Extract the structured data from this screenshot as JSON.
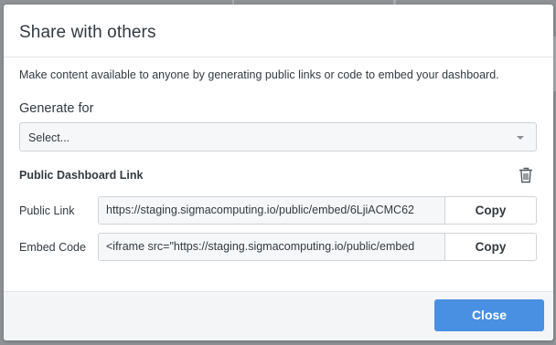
{
  "dialog": {
    "title": "Share with others",
    "description": "Make content available to anyone by generating public links or code to embed your dashboard.",
    "generate_label": "Generate for",
    "select": {
      "value": "Select..."
    },
    "section_title": "Public Dashboard Link",
    "rows": [
      {
        "label": "Public Link",
        "value": "https://staging.sigmacomputing.io/public/embed/6LjiACMC62",
        "copy_label": "Copy"
      },
      {
        "label": "Embed Code",
        "value": "<iframe src=\"https://staging.sigmacomputing.io/public/embed",
        "copy_label": "Copy"
      }
    ],
    "close_label": "Close"
  },
  "icons": {
    "select_caret": "chevron-down-icon",
    "delete": "trash-icon"
  },
  "colors": {
    "primary": "#4a90e2",
    "text": "#333a40",
    "border": "#cfd3d7",
    "input_bg": "#f6f7f8",
    "footer_bg": "#f4f5f6"
  }
}
